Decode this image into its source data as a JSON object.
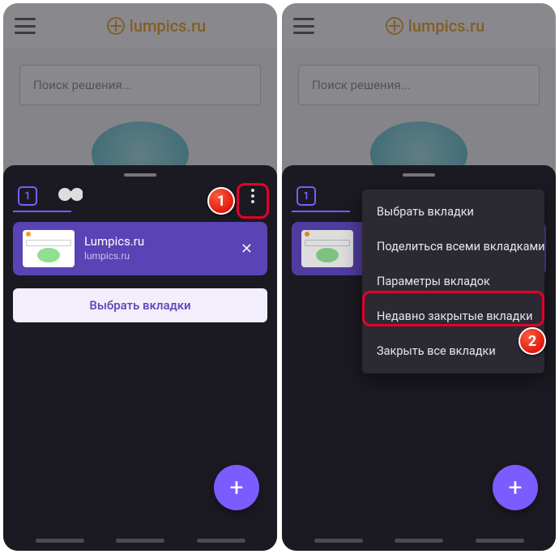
{
  "brand": {
    "name": "lumpics.ru"
  },
  "search": {
    "placeholder": "Поиск решения..."
  },
  "tabSwitcher": {
    "count": "1",
    "card": {
      "title": "Lumpics.ru",
      "url": "lumpics.ru"
    },
    "selectButton": "Выбрать вкладки"
  },
  "menu": {
    "items": [
      "Выбрать вкладки",
      "Поделиться всеми вкладками",
      "Параметры вкладок",
      "Недавно закрытые вкладки",
      "Закрыть все вкладки"
    ]
  },
  "callouts": {
    "one": "1",
    "two": "2"
  }
}
